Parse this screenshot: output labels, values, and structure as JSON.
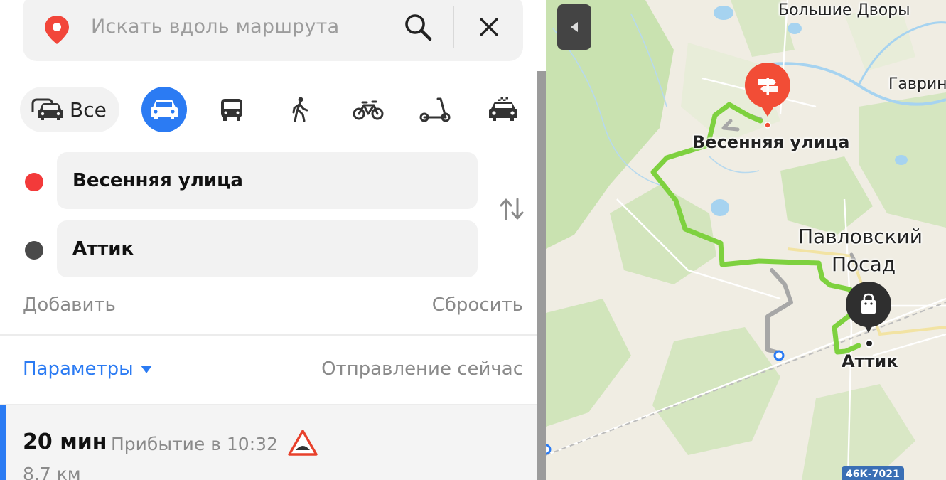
{
  "search": {
    "placeholder": "Искать вдоль маршрута",
    "icons": {
      "pin": "map-pin-icon",
      "search": "search-icon",
      "close": "close-icon"
    }
  },
  "modes": {
    "all_label": "Все",
    "selected": "car",
    "items": [
      "all",
      "car",
      "bus",
      "walk",
      "bike",
      "scooter",
      "taxi"
    ]
  },
  "route_points": {
    "from": "Весенняя улица",
    "to": "Аттик",
    "from_color": "#f33a3a",
    "to_color": "#4a4a4a"
  },
  "actions": {
    "add_label": "Добавить",
    "reset_label": "Сбросить"
  },
  "options": {
    "params_label": "Параметры",
    "departure_label": "Отправление сейчас"
  },
  "route": {
    "time": "20 мин",
    "arrival": "Прибытие в 10:32",
    "distance": "8,7 км",
    "warning_icon": "speed-bump-warning-icon"
  },
  "map": {
    "labels": {
      "bolshie_dvory": "Большие Дворы",
      "gavrino": "Гаврин",
      "vesennyaya": "Весенняя улица",
      "pavlovsky_1": "Павловский",
      "pavlovsky_2": "Посад",
      "attik": "Аттик"
    },
    "road_shield": "46К-7021",
    "colors": {
      "route": "#7ed13f",
      "alt_route": "#a7a7a7",
      "accent": "#2b7bf3",
      "destination_pin": "#f24d36",
      "water": "#a6d3f0",
      "forest": "#c9e2b0"
    }
  }
}
